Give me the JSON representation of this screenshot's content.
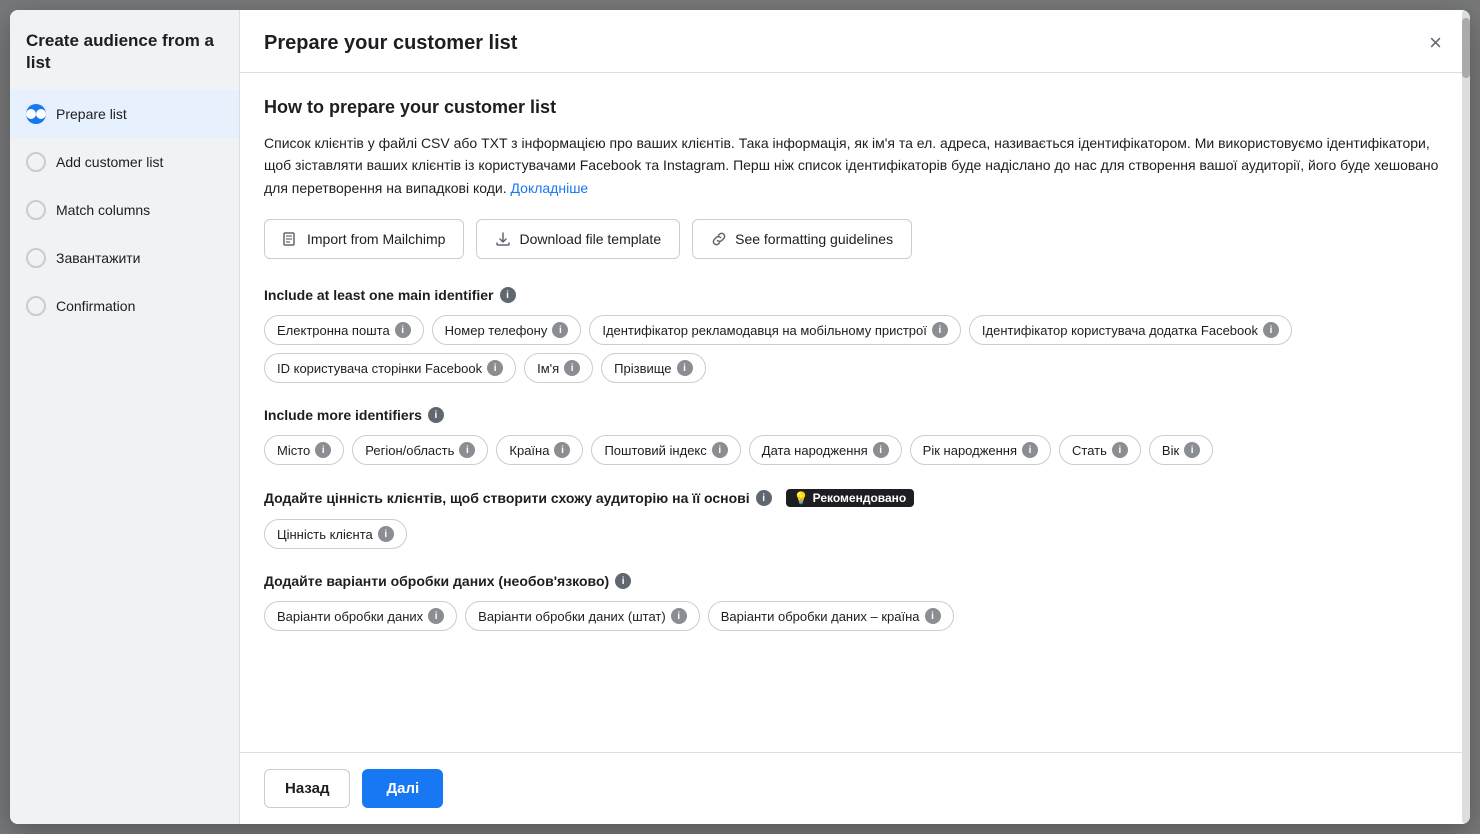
{
  "sidebar": {
    "title": "Create audience from a list",
    "items": [
      {
        "id": "prepare",
        "label": "Prepare list",
        "active": true
      },
      {
        "id": "add",
        "label": "Add customer list",
        "active": false
      },
      {
        "id": "match",
        "label": "Match columns",
        "active": false
      },
      {
        "id": "upload",
        "label": "Завантажити",
        "active": false
      },
      {
        "id": "confirm",
        "label": "Confirmation",
        "active": false
      }
    ]
  },
  "header": {
    "title": "Prepare your customer list",
    "close_label": "×"
  },
  "main": {
    "section_title": "How to prepare your customer list",
    "description_part1": "Список клієнтів у файлі CSV або TXT з інформацією про ваших клієнтів. Така інформація, як ім'я та ел. адреса, називається ідентифікатором. Ми використовуємо ідентифікатори, щоб зіставляти ваших клієнтів із користувачами Facebook та Instagram. Перш ніж список ідентифікаторів буде надіслано до нас для створення вашої аудиторії, його буде хешовано для перетворення на випадкові коди.",
    "description_link": "Докладніше",
    "buttons": [
      {
        "id": "mailchimp",
        "icon": "📋",
        "label": "Import from Mailchimp"
      },
      {
        "id": "download",
        "icon": "⬇",
        "label": "Download file template"
      },
      {
        "id": "guidelines",
        "icon": "🔗",
        "label": "See formatting guidelines"
      }
    ],
    "main_identifier_label": "Include at least one main identifier",
    "main_identifiers": [
      "Електронна пошта",
      "Номер телефону",
      "Ідентифікатор рекламодавця на мобільному пристрої",
      "Ідентифікатор користувача додатка Facebook",
      "ID користувача сторінки Facebook",
      "Ім'я",
      "Прізвище"
    ],
    "more_identifier_label": "Include more identifiers",
    "more_identifiers": [
      "Місто",
      "Регіон/область",
      "Країна",
      "Поштовий індекс",
      "Дата народження",
      "Рік народження",
      "Стать",
      "Вік"
    ],
    "value_section_label": "Додайте цінність клієнтів, щоб створити схожу аудиторію на її основі",
    "recommended_label": "Рекомендовано",
    "value_identifiers": [
      "Цінність клієнта"
    ],
    "processing_section_label": "Додайте варіанти обробки даних (необов'язково)",
    "processing_identifiers": [
      "Варіанти обробки даних",
      "Варіанти обробки даних (штат)",
      "Варіанти обробки даних – країна"
    ]
  },
  "footer": {
    "back_label": "Назад",
    "next_label": "Далі"
  }
}
